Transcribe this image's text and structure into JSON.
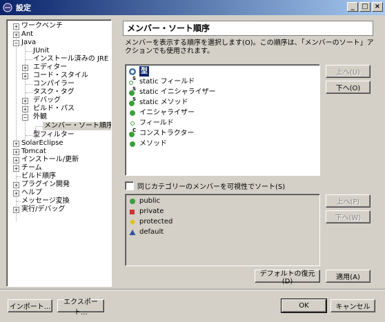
{
  "window": {
    "title": "設定"
  },
  "tree": {
    "items": [
      {
        "label": "ワークベンチ",
        "expander": "+"
      },
      {
        "label": "Ant",
        "expander": "+"
      },
      {
        "label": "Java",
        "expander": "−"
      },
      {
        "label": "JUnit",
        "expander": ""
      },
      {
        "label": "インストール済みの JRE",
        "expander": ""
      },
      {
        "label": "エディター",
        "expander": "+"
      },
      {
        "label": "コード・スタイル",
        "expander": "+"
      },
      {
        "label": "コンパイラー",
        "expander": ""
      },
      {
        "label": "タスク・タグ",
        "expander": ""
      },
      {
        "label": "デバッグ",
        "expander": "+"
      },
      {
        "label": "ビルド・パス",
        "expander": "+"
      },
      {
        "label": "外観",
        "expander": "−"
      },
      {
        "label": "メンバー・ソート順序",
        "expander": ""
      },
      {
        "label": "型フィルター",
        "expander": ""
      },
      {
        "label": "SolarEclipse",
        "expander": "+"
      },
      {
        "label": "Tomcat",
        "expander": "+"
      },
      {
        "label": "インストール/更新",
        "expander": "+"
      },
      {
        "label": "チーム",
        "expander": "+"
      },
      {
        "label": "ビルド順序",
        "expander": ""
      },
      {
        "label": "プラグイン開発",
        "expander": "+"
      },
      {
        "label": "ヘルプ",
        "expander": "+"
      },
      {
        "label": "メッセージ変換",
        "expander": ""
      },
      {
        "label": "実行/デバッグ",
        "expander": "+"
      }
    ]
  },
  "page": {
    "title": "メンバー・ソート順序",
    "description": "メンバーを表示する順序を選択します(O)。この順序は、「メンバーのソート」アクションでも使用されます。"
  },
  "member_list": {
    "items": [
      {
        "label": "型",
        "icon": "type-icon"
      },
      {
        "label": "static フィールド",
        "icon": "static-field-icon"
      },
      {
        "label": "static イニシャライザー",
        "icon": "static-initializer-icon"
      },
      {
        "label": "static メソッド",
        "icon": "static-method-icon"
      },
      {
        "label": "イニシャライザー",
        "icon": "initializer-icon"
      },
      {
        "label": "フィールド",
        "icon": "field-icon"
      },
      {
        "label": "コンストラクター",
        "icon": "constructor-icon"
      },
      {
        "label": "メソッド",
        "icon": "method-icon"
      }
    ],
    "up_label": "上へ(U)",
    "down_label": "下へ(O)"
  },
  "visibility_checkbox": {
    "label": "同じカテゴリーのメンバーを可視性でソート(S)"
  },
  "visibility_list": {
    "items": [
      {
        "label": "public",
        "icon": "public-icon",
        "color": "#3aa03a"
      },
      {
        "label": "private",
        "icon": "private-icon",
        "color": "#d03030"
      },
      {
        "label": "protected",
        "icon": "protected-icon",
        "color": "#e0c020"
      },
      {
        "label": "default",
        "icon": "default-icon",
        "color": "#3050a0"
      }
    ],
    "up_label": "上へ(P)",
    "down_label": "下へ(W)"
  },
  "buttons": {
    "restore_defaults": "デフォルトの復元(D)",
    "apply": "適用(A)",
    "import": "インポート...",
    "export": "エクスポート...",
    "ok": "OK",
    "cancel": "キャンセル"
  }
}
